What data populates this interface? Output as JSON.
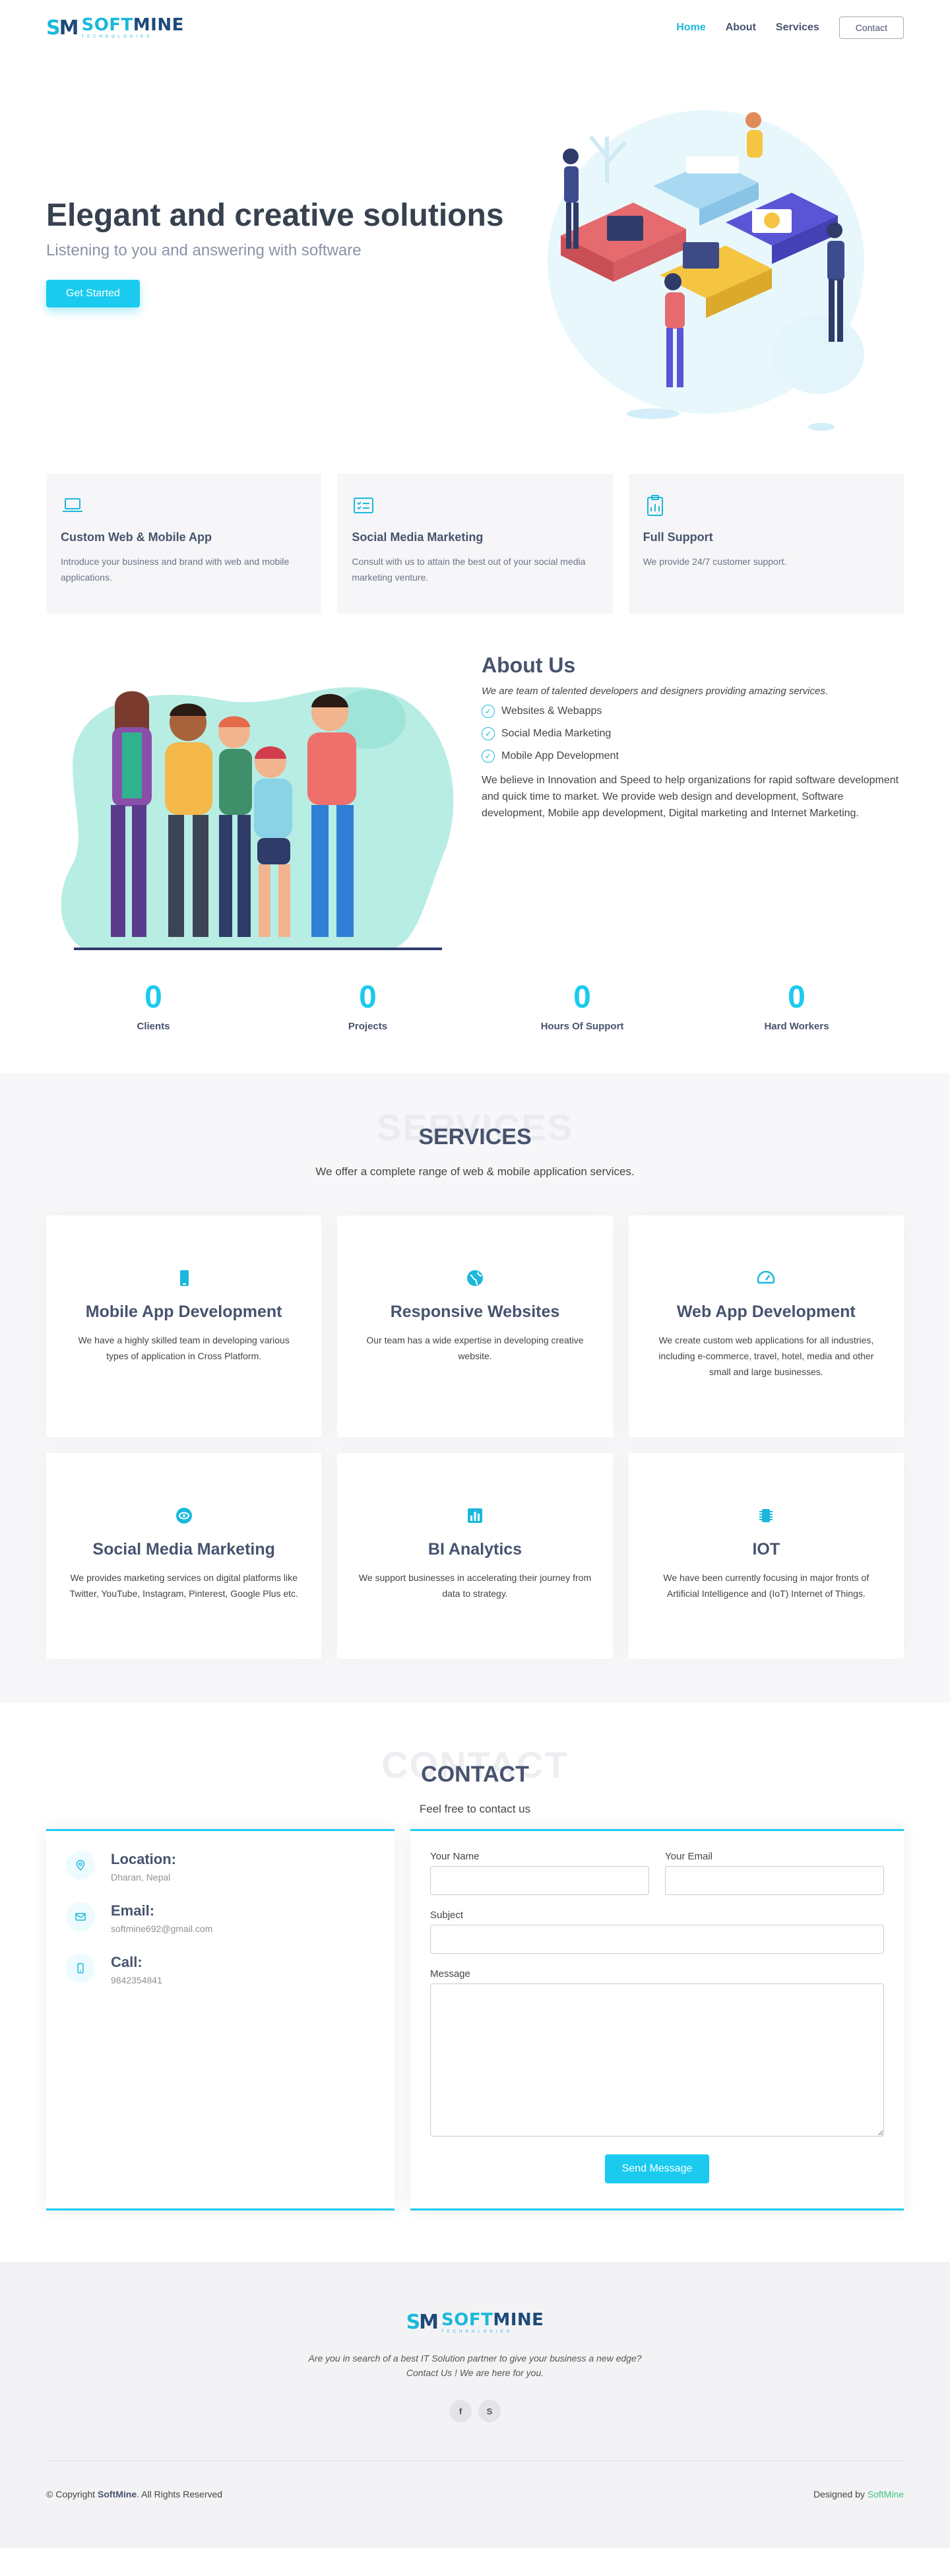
{
  "brand": {
    "mark_a": "S",
    "mark_b": "M",
    "word_a": "SOFT",
    "word_b": "MINE",
    "tagline": "TECHNOLOGIES"
  },
  "nav": {
    "home": "Home",
    "about": "About",
    "services": "Services",
    "contact": "Contact"
  },
  "hero": {
    "title": "Elegant and creative solutions",
    "subtitle": "Listening to you and answering with software",
    "cta": "Get Started"
  },
  "features": [
    {
      "icon": "laptop-icon",
      "title": "Custom Web & Mobile App",
      "text": "Introduce your business and brand with web and mobile applications."
    },
    {
      "icon": "list-card-icon",
      "title": "Social Media Marketing",
      "text": "Consult with us to attain the best out of your social media marketing venture."
    },
    {
      "icon": "clipboard-chart-icon",
      "title": "Full Support",
      "text": "We provide 24/7 customer support."
    }
  ],
  "about": {
    "title": "About Us",
    "lead": "We are team of talented developers and designers providing amazing services.",
    "checks": [
      "Websites & Webapps",
      "Social Media Marketing",
      "Mobile App Development"
    ],
    "para": "We believe in Innovation and Speed to help organizations for rapid software development and quick time to market. We provide web design and development, Software development, Mobile app development, Digital marketing and Internet Marketing."
  },
  "counts": [
    {
      "num": "0",
      "label": "Clients"
    },
    {
      "num": "0",
      "label": "Projects"
    },
    {
      "num": "0",
      "label": "Hours Of Support"
    },
    {
      "num": "0",
      "label": "Hard Workers"
    }
  ],
  "services": {
    "bg_title": "SERVICES",
    "title": "SERVICES",
    "subtitle": "We offer a complete range of web & mobile application services.",
    "items": [
      {
        "icon": "phone-icon",
        "title": "Mobile App Development",
        "text": "We have a highly skilled team in developing various types of application in Cross Platform."
      },
      {
        "icon": "globe-icon",
        "title": "Responsive Websites",
        "text": "Our team has a wide expertise in developing creative website."
      },
      {
        "icon": "speedometer-icon",
        "title": "Web App Development",
        "text": "We create custom web applications for all industries, including e-commerce, travel, hotel, media and other small and large businesses."
      },
      {
        "icon": "share-eye-icon",
        "title": "Social Media Marketing",
        "text": "We provides marketing services on digital platforms like Twitter, YouTube, Instagram, Pinterest, Google Plus etc."
      },
      {
        "icon": "bar-chart-icon",
        "title": "BI Analytics",
        "text": "We support businesses in accelerating their journey from data to strategy."
      },
      {
        "icon": "chip-icon",
        "title": "IOT",
        "text": "We have been currently focusing in major fronts of Artificial Intelligence and (IoT) Internet of Things."
      }
    ]
  },
  "contact": {
    "bg_title": "CONTACT",
    "title": "CONTACT",
    "subtitle": "Feel free to contact us",
    "location_label": "Location:",
    "location_value": "Dharan, Nepal",
    "email_label": "Email:",
    "email_value": "softmine692@gmail.com",
    "call_label": "Call:",
    "call_value": "9842354841",
    "form": {
      "name_label": "Your Name",
      "email_label": "Your Email",
      "subject_label": "Subject",
      "message_label": "Message",
      "send": "Send Message"
    }
  },
  "footer": {
    "tagline_1": "Are you in search of a best IT Solution partner to give your business a new edge?",
    "tagline_2": "Contact Us ! We are here for you.",
    "social_1": "f",
    "social_2": "S",
    "copy_prefix": "© Copyright",
    "copy_brand": "SoftMine",
    "copy_suffix": ". All Rights Reserved",
    "designed_prefix": "Designed by",
    "designed_brand": "SoftMine"
  },
  "colors": {
    "accent": "#1bcbef",
    "heading": "#47536e",
    "brand_dark": "#1d4a7a"
  }
}
